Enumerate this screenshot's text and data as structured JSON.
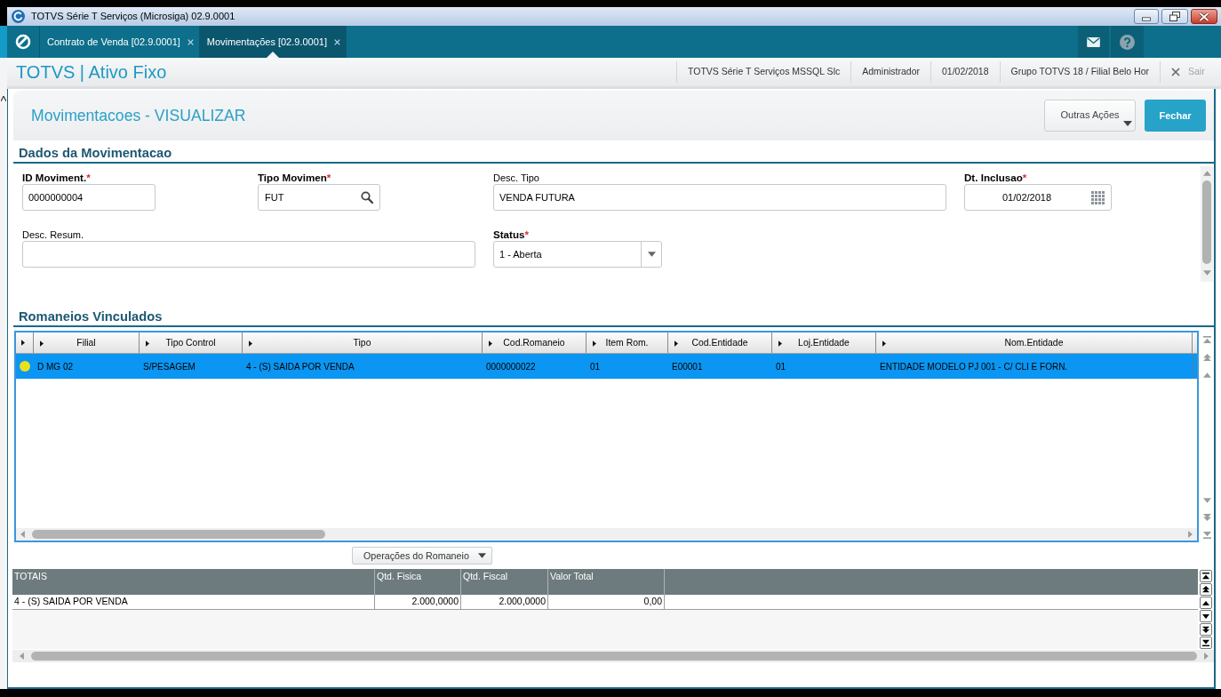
{
  "window": {
    "title": "TOTVS Série T Serviços (Microsiga) 02.9.0001"
  },
  "tabs": [
    {
      "label": "Contrato de Venda [02.9.0001]",
      "selected": false
    },
    {
      "label": "Movimentações [02.9.0001]",
      "selected": true
    }
  ],
  "header": {
    "app_title": "TOTVS | Ativo Fixo",
    "info": [
      "TOTVS Série T Serviços MSSQL Slc",
      "Administrador",
      "01/02/2018",
      "Grupo TOTVS 18 / Filial Belo Hor"
    ],
    "logout": "Sair"
  },
  "page": {
    "title": "Movimentacoes - VISUALIZAR",
    "buttons": [
      {
        "label": "Outras Ações",
        "kind": "dropdown"
      },
      {
        "label": "Fechar",
        "kind": "primary"
      }
    ]
  },
  "form": {
    "title": "Dados da Movimentacao",
    "rows": [
      [
        {
          "label": "ID Moviment.",
          "required_mark": "*",
          "kind": "text",
          "value": "0000000004"
        },
        {
          "label": "Tipo Movimen",
          "required_mark": "*",
          "kind": "lookup",
          "value": "FUT"
        },
        {
          "label": "Desc. Tipo",
          "kind": "text",
          "value": "VENDA FUTURA"
        },
        {
          "label": "Dt. Inclusao",
          "required_mark": "*",
          "kind": "date",
          "value": "01/02/2018"
        }
      ],
      [
        {
          "label": "Desc. Resum.",
          "kind": "text"
        },
        "",
        {
          "label": "Status",
          "required_mark": "*",
          "kind": "select",
          "value": "1 - Aberta"
        }
      ]
    ]
  },
  "romaneios": {
    "title": "Romaneios Vinculados",
    "columns": [
      "Filial",
      "Tipo Control",
      "Tipo",
      "Cod.Romaneio",
      "Item Rom.",
      "Cod.Entidade",
      "Loj.Entidade",
      "Nom.Entidade"
    ],
    "rows": [
      {
        "selected": true,
        "color": "#e8e21c",
        "cells": [
          "D MG 02",
          "S/PESAGEM",
          "4 - (S) SAIDA POR VENDA",
          "0000000022",
          "01",
          "E00001",
          "01",
          "ENTIDADE MODELO PJ 001 - C/ CLI E FORN."
        ]
      }
    ],
    "action": "Operações do Romaneio"
  },
  "totals": {
    "columns": [
      "TOTAIS",
      "Qtd. Fisica",
      "Qtd. Fiscal",
      "Valor Total"
    ],
    "rows": [
      [
        "4 - (S) SAIDA POR VENDA",
        "2.000,0000",
        "2.000,0000",
        "0,00"
      ]
    ]
  }
}
